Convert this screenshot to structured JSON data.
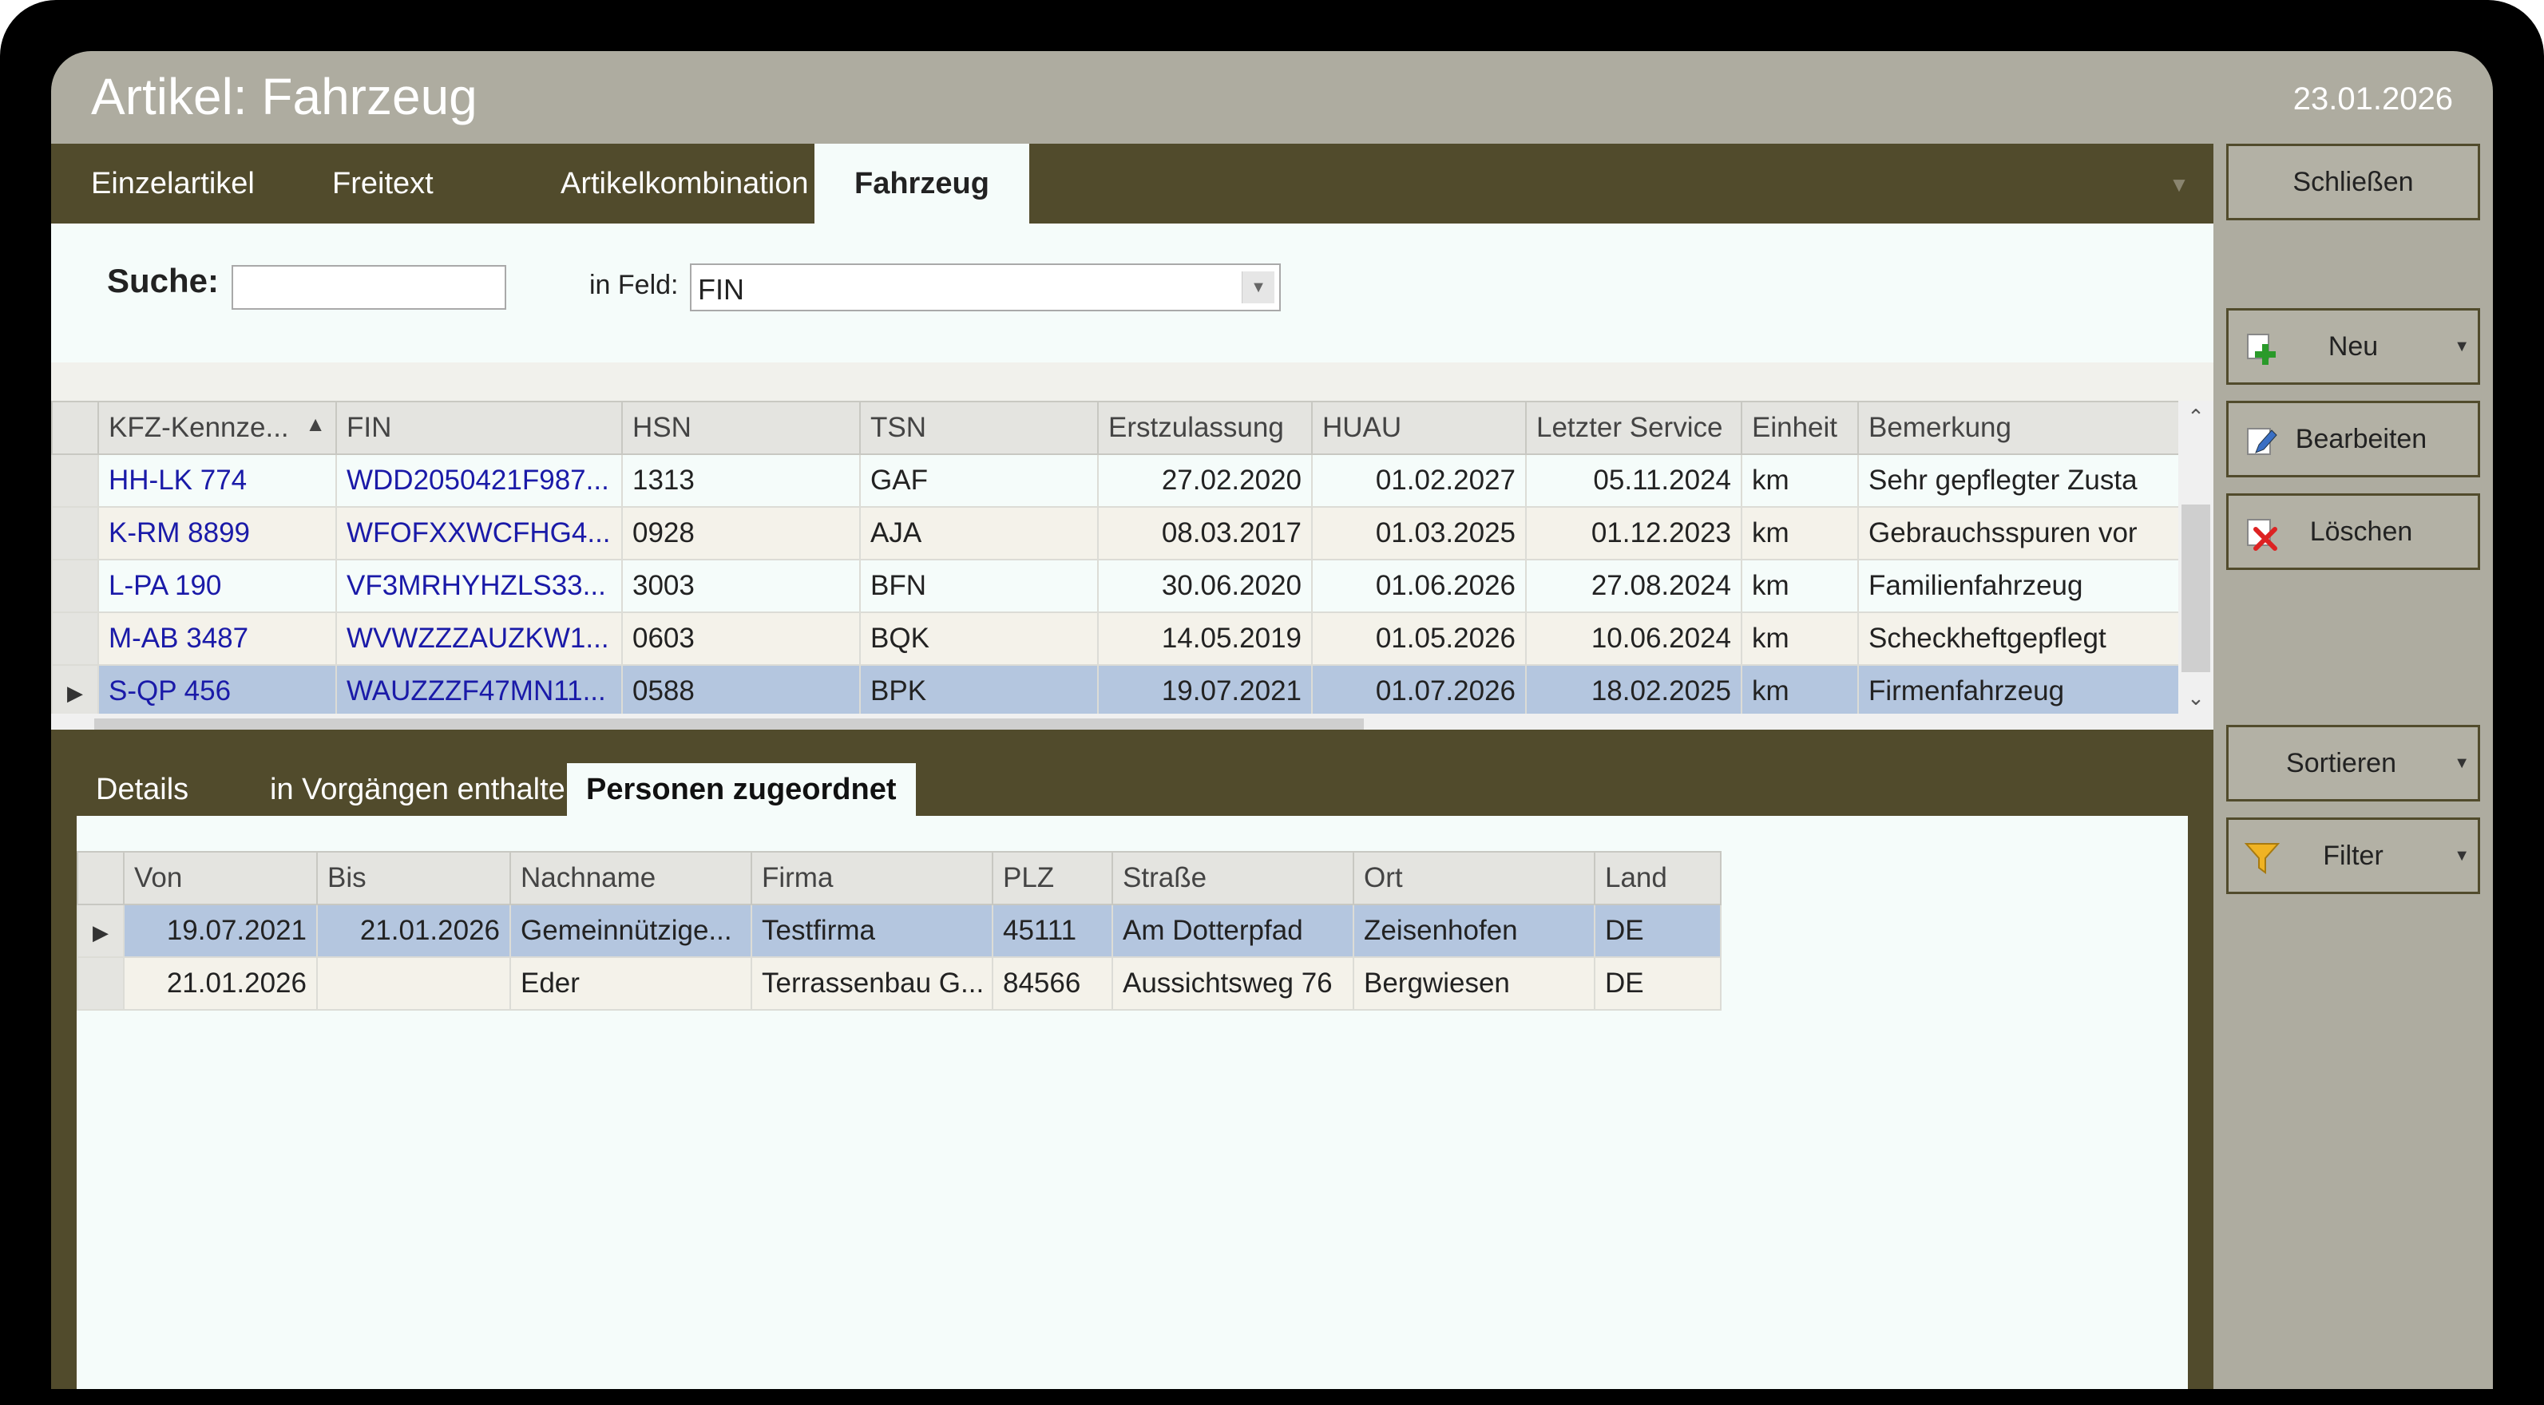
{
  "window": {
    "title": "Artikel: Fahrzeug",
    "date": "23.01.2026"
  },
  "tabs": [
    "Einzelartikel",
    "Freitext",
    "Artikelkombination",
    "Fahrzeug"
  ],
  "search": {
    "label": "Suche:",
    "value": "",
    "field_label": "in Feld:",
    "field_value": "FIN"
  },
  "vehicles": {
    "columns": [
      "KFZ-Kennze...",
      "FIN",
      "HSN",
      "TSN",
      "Erstzulassung",
      "HUAU",
      "Letzter Service",
      "Einheit",
      "Bemerkung"
    ],
    "rows": [
      [
        "HH-LK 774",
        "WDD2050421F987...",
        "1313",
        "GAF",
        "27.02.2020",
        "01.02.2027",
        "05.11.2024",
        "km",
        "Sehr gepflegter Zusta"
      ],
      [
        "K-RM 8899",
        "WFOFXXWCFHG4...",
        "0928",
        "AJA",
        "08.03.2017",
        "01.03.2025",
        "01.12.2023",
        "km",
        "Gebrauchsspuren vor"
      ],
      [
        "L-PA 190",
        "VF3MRHYHZLS33...",
        "3003",
        "BFN",
        "30.06.2020",
        "01.06.2026",
        "27.08.2024",
        "km",
        "Familienfahrzeug"
      ],
      [
        "M-AB 3487",
        "WVWZZZAUZKW1...",
        "0603",
        "BQK",
        "14.05.2019",
        "01.05.2026",
        "10.06.2024",
        "km",
        "Scheckheftgepflegt"
      ],
      [
        "S-QP 456",
        "WAUZZZF47MN11...",
        "0588",
        "BPK",
        "19.07.2021",
        "01.07.2026",
        "18.02.2025",
        "km",
        "Firmenfahrzeug"
      ]
    ],
    "selected_row": 4
  },
  "lower_tabs": [
    "Details",
    "in Vorgängen enthalten",
    "Personen zugeordnet"
  ],
  "persons": {
    "columns": [
      "Von",
      "Bis",
      "Nachname",
      "Firma",
      "PLZ",
      "Straße",
      "Ort",
      "Land"
    ],
    "rows": [
      [
        "19.07.2021",
        "21.01.2026",
        "Gemeinnützige...",
        "Testfirma",
        "45111",
        "Am Dotterpfad",
        "Zeisenhofen",
        "DE"
      ],
      [
        "21.01.2026",
        "",
        "Eder",
        "Terrassenbau G...",
        "84566",
        "Aussichtsweg 76",
        "Bergwiesen",
        "DE"
      ]
    ],
    "selected_row": 0
  },
  "side_buttons": {
    "close": "Schließen",
    "new": "Neu",
    "edit": "Bearbeiten",
    "delete": "Löschen",
    "sort": "Sortieren",
    "filter": "Filter"
  },
  "colors": {
    "frame": "#514b2c",
    "window": "#aeaca0",
    "content": "#f5fcfa",
    "selection": "#b4c6df",
    "link": "#1a1aa8"
  }
}
